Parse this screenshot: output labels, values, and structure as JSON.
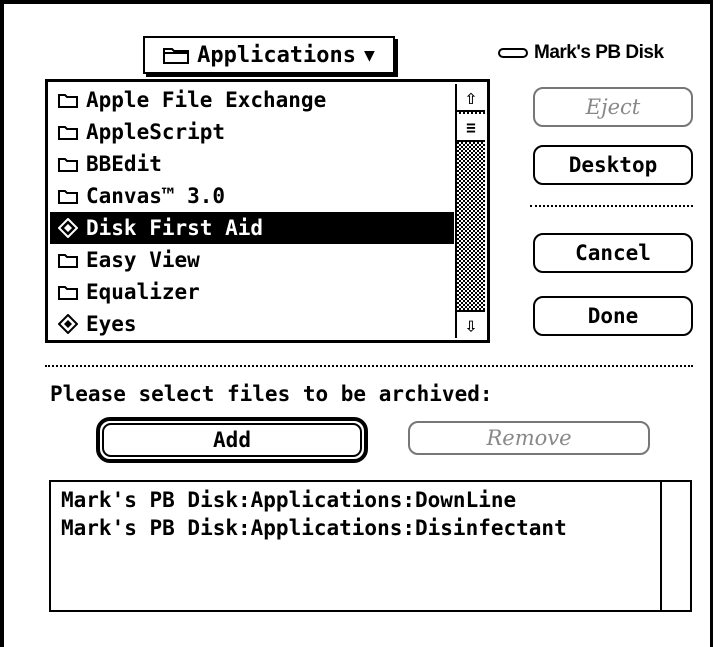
{
  "folder_popup": {
    "label": "Applications",
    "icon": "folder-icon",
    "arrow": "▼"
  },
  "volume": {
    "name": "Mark's PB Disk",
    "icon": "disk-icon"
  },
  "file_list": {
    "items": [
      {
        "name": "Apple File Exchange",
        "icon": "folder-icon",
        "selected": false
      },
      {
        "name": "AppleScript",
        "icon": "folder-icon",
        "selected": false
      },
      {
        "name": "BBEdit",
        "icon": "folder-icon",
        "selected": false
      },
      {
        "name": "Canvas™ 3.0",
        "icon": "folder-icon",
        "selected": false
      },
      {
        "name": "Disk First Aid",
        "icon": "application-icon",
        "selected": true
      },
      {
        "name": "Easy View",
        "icon": "folder-icon",
        "selected": false
      },
      {
        "name": "Equalizer",
        "icon": "folder-icon",
        "selected": false
      },
      {
        "name": "Eyes",
        "icon": "application-icon",
        "selected": false
      }
    ],
    "scroll_up": "⇧",
    "scroll_down": "⇩",
    "scroll_thumb": "≡"
  },
  "buttons": {
    "eject": "Eject",
    "desktop": "Desktop",
    "cancel": "Cancel",
    "done": "Done",
    "add": "Add",
    "remove": "Remove"
  },
  "prompt": "Please select files to be archived:",
  "selected_files": [
    "Mark's PB Disk:Applications:DownLine",
    "Mark's PB Disk:Applications:Disinfectant"
  ]
}
